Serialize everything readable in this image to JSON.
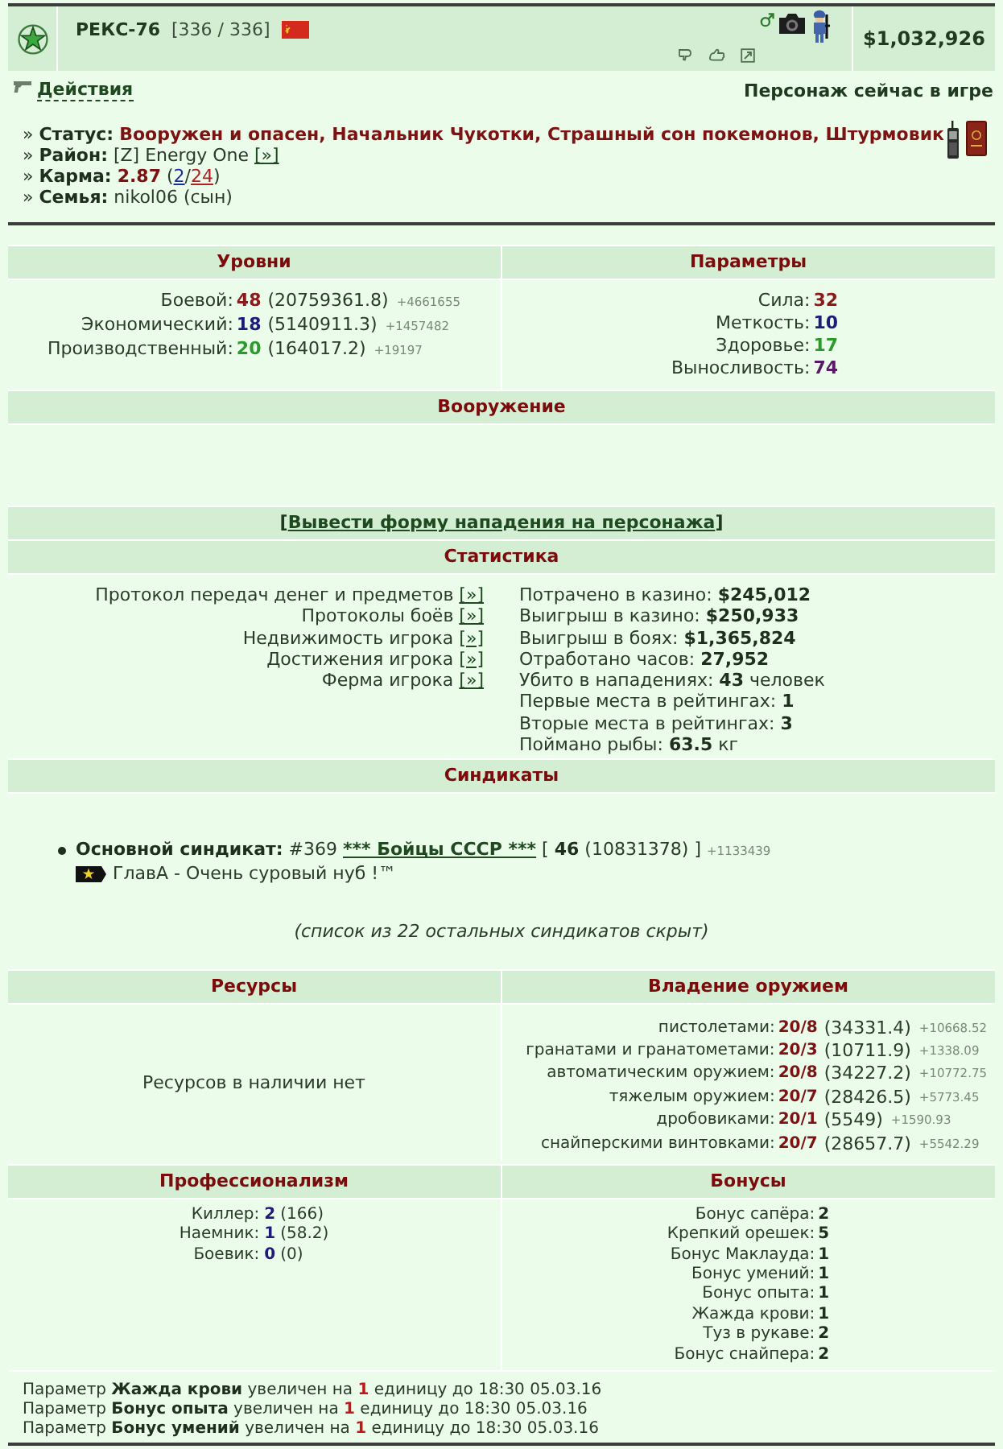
{
  "header": {
    "name": "РЕКС-76",
    "health": "[336 / 336]",
    "money": "$1,032,926"
  },
  "actions": {
    "label": "Действия",
    "presence": "Персонаж сейчас в игре"
  },
  "info": [
    {
      "kind": "status",
      "marker": "»",
      "label": "Статус:",
      "value": "Вооружен и опасен, Начальник Чукотки, Страшный сон покемонов, Штурмовик"
    },
    {
      "kind": "district",
      "marker": "»",
      "label": "Район:",
      "value": "[Z] Energy One",
      "link": "[»]"
    },
    {
      "kind": "karma",
      "marker": "»",
      "label": "Карма:",
      "value": "2.87",
      "open": "(",
      "positive": "2",
      "separator": "/",
      "negative": "24",
      "close": ")"
    },
    {
      "kind": "family",
      "marker": "»",
      "label": "Семья:",
      "value": "nikol06 (сын)"
    }
  ],
  "levels": {
    "title": "Уровни",
    "rows": [
      {
        "label": "Боевой:",
        "value": "48",
        "experience": "(20759361.8)",
        "gain": "+4661655",
        "color": "#8b1a1a"
      },
      {
        "label": "Экономический:",
        "value": "18",
        "experience": "(5140911.3)",
        "gain": "+1457482",
        "color": "#1c1c7a"
      },
      {
        "label": "Производственный:",
        "value": "20",
        "experience": "(164017.2)",
        "gain": "+19197",
        "color": "#2a9a2a"
      }
    ]
  },
  "parameters": {
    "title": "Параметры",
    "rows": [
      {
        "label": "Сила:",
        "value": "32",
        "color": "#8b1a1a"
      },
      {
        "label": "Меткость:",
        "value": "10",
        "color": "#1c1c7a"
      },
      {
        "label": "Здоровье:",
        "value": "17",
        "color": "#2a9a2a"
      },
      {
        "label": "Выносливость:",
        "value": "74",
        "color": "#5a1a6a"
      }
    ]
  },
  "armament": {
    "title": "Вооружение"
  },
  "attack_form": {
    "open": "[",
    "link": "Вывести форму нападения на персонажа",
    "close": "]"
  },
  "statistics": {
    "title": "Статистика",
    "links": [
      {
        "label": "Протокол передач денег и предметов",
        "link": "[»]"
      },
      {
        "label": "Протоколы боёв",
        "link": "[»]"
      },
      {
        "label": "Недвижимость игрока",
        "link": "[»]"
      },
      {
        "label": "Достижения игрока",
        "link": "[»]"
      },
      {
        "label": "Ферма игрока",
        "link": "[»]"
      }
    ],
    "stats": [
      {
        "label": "Потрачено в казино:",
        "value": "$245,012"
      },
      {
        "label": "Выигрыш в казино:",
        "value": "$250,933"
      },
      {
        "label": "Выигрыш в боях:",
        "value": "$1,365,824"
      },
      {
        "label": "Отработано часов:",
        "value": "27,952"
      },
      {
        "label": "Убито в нападениях:",
        "value": "43",
        "unit": "человек"
      },
      {
        "label": "Первые места в рейтингах:",
        "value": "1"
      },
      {
        "label": "Вторые места в рейтингах:",
        "value": "3"
      },
      {
        "label": "Поймано рыбы:",
        "value": "63.5",
        "unit": "кг"
      }
    ]
  },
  "syndicates": {
    "title": "Синдикаты",
    "main": {
      "label": "Основной синдикат:",
      "number": "#369",
      "name": "*** Бойцы СССР ***",
      "open": "[",
      "rank_level": "46",
      "points": "(10831378)",
      "close": "]",
      "gain": "+1133439",
      "role": "ГлавА - Очень суровый нуб !™"
    },
    "hidden_note": "(список из 22 остальных синдикатов скрыт)"
  },
  "resources": {
    "title": "Ресурсы",
    "empty_note": "Ресурсов в наличии нет"
  },
  "weapon_skills": {
    "title": "Владение оружием",
    "rows": [
      {
        "label": "пистолетами:",
        "value": "20/8",
        "experience": "(34331.4)",
        "gain": "+10668.52"
      },
      {
        "label": "гранатами и гранатометами:",
        "value": "20/3",
        "experience": "(10711.9)",
        "gain": "+1338.09"
      },
      {
        "label": "автоматическим оружием:",
        "value": "20/8",
        "experience": "(34227.2)",
        "gain": "+10772.75"
      },
      {
        "label": "тяжелым оружием:",
        "value": "20/7",
        "experience": "(28426.5)",
        "gain": "+5773.45"
      },
      {
        "label": "дробовиками:",
        "value": "20/1",
        "experience": "(5549)",
        "gain": "+1590.93"
      },
      {
        "label": "снайперскими винтовками:",
        "value": "20/7",
        "experience": "(28657.7)",
        "gain": "+5542.29"
      }
    ]
  },
  "professionalism": {
    "title": "Профессионализм",
    "rows": [
      {
        "label": "Киллер:",
        "value": "2",
        "points": "(166)"
      },
      {
        "label": "Наемник:",
        "value": "1",
        "points": "(58.2)"
      },
      {
        "label": "Боевик:",
        "value": "0",
        "points": "(0)"
      }
    ]
  },
  "bonuses": {
    "title": "Бонусы",
    "rows": [
      {
        "label": "Бонус сапёра:",
        "value": "2"
      },
      {
        "label": "Крепкий орешек:",
        "value": "5"
      },
      {
        "label": "Бонус Маклауда:",
        "value": "1"
      },
      {
        "label": "Бонус умений:",
        "value": "1"
      },
      {
        "label": "Бонус опыта:",
        "value": "1"
      },
      {
        "label": "Жажда крови:",
        "value": "1"
      },
      {
        "label": "Туз в рукаве:",
        "value": "2"
      },
      {
        "label": "Бонус снайпера:",
        "value": "2"
      }
    ]
  },
  "notices": [
    {
      "before": "Параметр",
      "param": "Жажда крови",
      "middle": "увеличен на",
      "amount": "1",
      "after": "единицу до 18:30 05.03.16"
    },
    {
      "before": "Параметр",
      "param": "Бонус опыта",
      "middle": "увеличен на",
      "amount": "1",
      "after": "единицу до 18:30 05.03.16"
    },
    {
      "before": "Параметр",
      "param": "Бонус умений",
      "middle": "увеличен на",
      "amount": "1",
      "after": "единицу до 18:30 05.03.16"
    }
  ]
}
